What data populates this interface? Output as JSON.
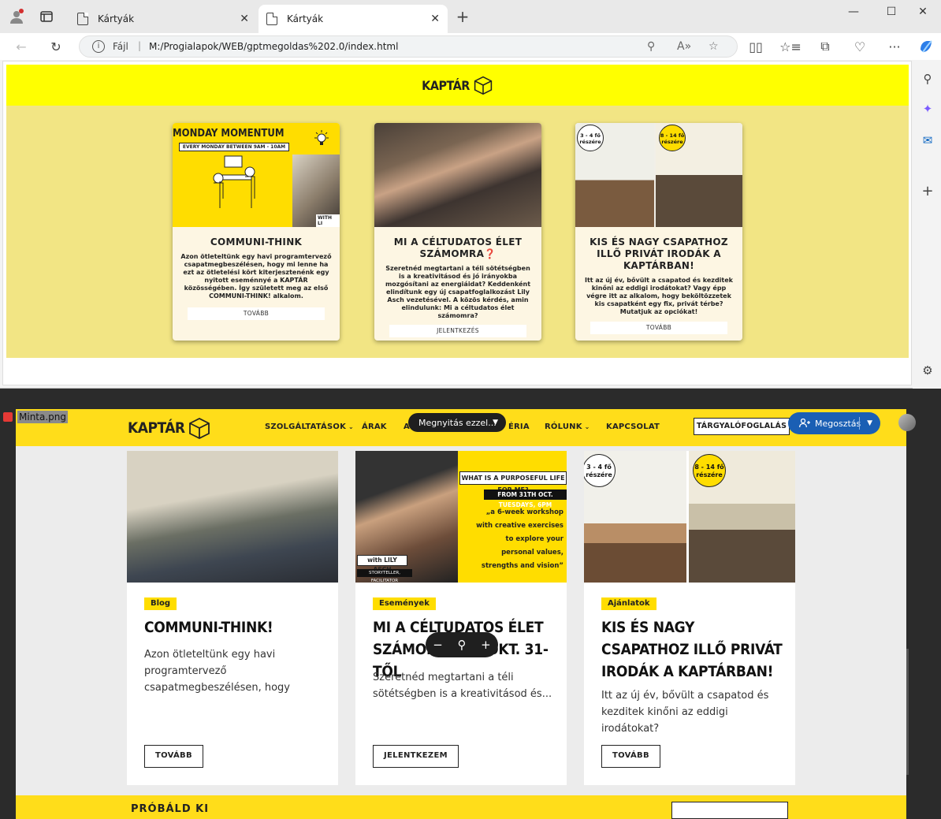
{
  "browser": {
    "tabs": [
      {
        "label": "Kártyák",
        "active": false
      },
      {
        "label": "Kártyák",
        "active": true
      }
    ],
    "address": {
      "scheme": "Fájl",
      "url": "M:/Progialapok/WEB/gptmegoldas%202.0/index.html"
    },
    "icons": [
      "profile-icon",
      "tab-actions-icon",
      "back-icon",
      "refresh-icon",
      "info-icon",
      "zoom-icon",
      "read-aloud-icon",
      "favorite-icon",
      "split-screen-icon",
      "favorites-icon",
      "collections-icon",
      "health-icon",
      "more-icon",
      "copilot-icon",
      "search-icon",
      "office-icon",
      "outlook-icon",
      "add-icon",
      "settings-icon"
    ]
  },
  "page": {
    "logo": "KAPTÁR",
    "cards": [
      {
        "image_title": "MONDAY MOMENTUM",
        "image_sub": "EVERY MONDAY BETWEEN  9AM - 10AM",
        "image_with": "WITH LI",
        "title": "COMMUNI-THINK",
        "text": "Azon ötleteltünk egy havi programtervező csapatmegbeszélésen, hogy mi lenne ha ezt az ötletelési kört kiterjesztenénk egy nyitott eseménnyé a KAPTÁR közösségében. Így született meg az első COMMUNI-THINK! alkalom.",
        "button": "TOVÁBB"
      },
      {
        "title": "MI A CÉLTUDATOS ÉLET SZÁMOMRA❓",
        "text": "Szeretnéd megtartani a téli sötétségben is a kreativitásod és jó irányokba mozgósítani az energiáidat? Keddenként elindítunk egy új csapatfoglalkozást Lily Asch vezetésével. A közös kérdés, amin elindulunk: Mi a céltudatos élet számomra?",
        "button": "JELENTKEZÉS"
      },
      {
        "badge_left": "3 - 4 fő részére",
        "badge_right": "8 - 14 fő részére",
        "title": "KIS ÉS NAGY CSAPATHOZ ILLŐ PRIVÁT IRODÁK A KAPTÁRBAN!",
        "text": "Itt az új év, bővült a csapatod és kezditek kinőni az eddigi irodátokat? Vagy épp végre itt az alkalom, hogy beköltözzetek kis csapatként egy fix, privát térbe? Mutatjuk az opciókat!",
        "button": "TOVÁBB"
      }
    ]
  },
  "viewer": {
    "file_name": "Minta.png",
    "open_with": "Megnyitás ezzel...",
    "share": "Megosztás",
    "site": {
      "logo": "KAPTÁR",
      "nav": [
        "SZOLGÁLTATÁSOK",
        "ÁRAK",
        "A",
        "ÉRIA",
        "RÓLUNK",
        "KAPCSOLAT"
      ],
      "booking": "TÁRGYALÓFOGLALÁS",
      "cards": [
        {
          "tag": "Blog",
          "title": "COMMUNI-THINK!",
          "text": "Azon ötleteltünk egy havi programtervező csapatmegbeszélésen, hogy",
          "button": "TOVÁBB"
        },
        {
          "tag": "Események",
          "title": "MI A CÉLTUDATOS ÉLET SZÁMOMRA ❓ OKT. 31-TŐL",
          "text": "Szeretnéd megtartani a téli sötétségben is a kreativitásod és...",
          "button": "JELENTKEZEM",
          "image_headline": "WHAT IS A PURPOSEFUL LIFE FOR ME?",
          "image_date": "FROM 31TH OCT. TUESDAYS, 6PM",
          "image_desc": "„a 6-week workshop with creative exercises to explore your personal values, strengths and vision”",
          "image_with": "with LILY ASCH",
          "image_role": "STORYTELLER, FACILITATOR"
        },
        {
          "tag": "Ajánlatok",
          "title": "KIS ÉS NAGY CSAPATHOZ ILLŐ PRIVÁT IRODÁK A KAPTÁRBAN!",
          "text": "Itt az új év, bővült a csapatod és kezditek kinőni az eddigi irodátokat?",
          "button": "TOVÁBB",
          "badge_left": "3 - 4 fő részére",
          "badge_right": "8 - 14 fő részére"
        }
      ],
      "bottom_text": "PRÓBÁLD KI"
    }
  }
}
